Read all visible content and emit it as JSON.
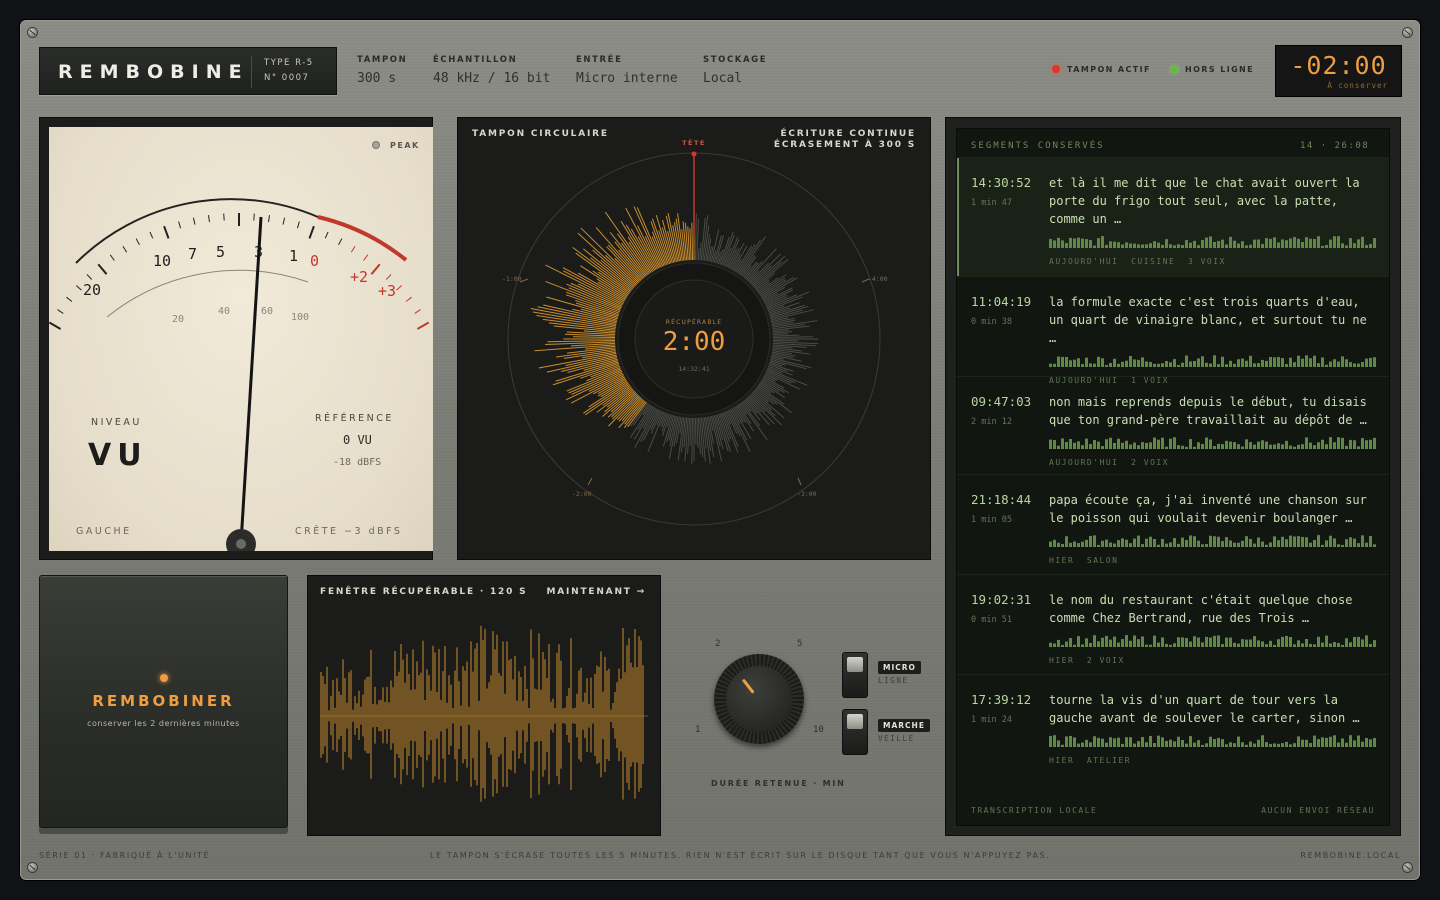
{
  "brand": {
    "name": "REMBOBINE",
    "type": "TYPE R-5",
    "serial": "N° 0007"
  },
  "specs": [
    {
      "label": "TAMPON",
      "value": "300 s"
    },
    {
      "label": "ÉCHANTILLON",
      "value": "48 kHz / 16 bit"
    },
    {
      "label": "ENTRÉE",
      "value": "Micro interne"
    },
    {
      "label": "STOCKAGE",
      "value": "Local"
    }
  ],
  "status": {
    "active": "TAMPON ACTIF",
    "offline": "HORS LIGNE",
    "active_color": "#d9372c",
    "offline_color": "#5bbf3a"
  },
  "timer": {
    "value": "-02:00",
    "sub": "À conserver"
  },
  "vu": {
    "peak": "PEAK",
    "scale_db": [
      "20",
      "10",
      "7",
      "5",
      "3",
      "1",
      "0",
      "+2",
      "+3"
    ],
    "scale_pct": [
      "20",
      "40",
      "60",
      "100"
    ],
    "niveau_label": "NIVEAU",
    "niveau_value": "VU",
    "reference_label": "RÉFÉRENCE",
    "reference_value": "0 VU",
    "reference_sub": "-18 dBFS",
    "left": "GAUCHE",
    "right": "CRÊTE −3 dBFS"
  },
  "circular": {
    "title": "TAMPON CIRCULAIRE",
    "mode_line1": "ÉCRITURE CONTINUE",
    "mode_line2": "ÉCRASEMENT À 300 S",
    "head": "TÊTE",
    "center_label": "RÉCUPÉRABLE",
    "center_value": "2:00",
    "center_time": "14:32:41",
    "ticks": [
      "-1:00",
      "-4:00",
      "-2:00",
      "-3:00"
    ]
  },
  "window": {
    "title": "FENÊTRE RÉCUPÉRABLE · 120 S",
    "now": "MAINTENANT →"
  },
  "rewind": {
    "label": "REMBOBINER",
    "sub": "conserver les 2 dernières minutes"
  },
  "knob": {
    "values": [
      "2",
      "5",
      "1",
      "10"
    ],
    "label": "DURÉE RETENUE · MIN",
    "current": 2
  },
  "toggles": [
    {
      "on": "MICRO",
      "off": "LIGNE"
    },
    {
      "on": "MARCHE",
      "off": "VEILLE"
    }
  ],
  "segments": {
    "title": "SEGMENTS CONSERVÉS",
    "count": "14",
    "total": "26:08",
    "items": [
      {
        "time": "14:30:52",
        "dur": "1 min 47",
        "lines": [
          "et là il me dit que le chat avait ouvert la",
          "porte du frigo tout seul, avec la patte,",
          "comme un …"
        ],
        "meta": "AUJOURD'HUI  CUISINE  3 VOIX"
      },
      {
        "time": "11:04:19",
        "dur": "0 min 38",
        "lines": [
          "la formule exacte c'est trois quarts d'eau,",
          "un quart de vinaigre blanc, et surtout tu ne",
          "…"
        ],
        "meta": "AUJOURD'HUI  1 VOIX"
      },
      {
        "time": "09:47:03",
        "dur": "2 min 12",
        "lines": [
          "non mais reprends depuis le début, tu disais",
          "que ton grand-père travaillait au dépôt de …"
        ],
        "meta": "AUJOURD'HUI  2 VOIX"
      },
      {
        "time": "21:18:44",
        "dur": "1 min 05",
        "lines": [
          "papa écoute ça, j'ai inventé une chanson sur",
          "le poisson qui voulait devenir boulanger …"
        ],
        "meta": "HIER  SALON"
      },
      {
        "time": "19:02:31",
        "dur": "0 min 51",
        "lines": [
          "le nom du restaurant c'était quelque chose",
          "comme Chez Bertrand, rue des Trois …"
        ],
        "meta": "HIER  2 VOIX"
      },
      {
        "time": "17:39:12",
        "dur": "1 min 24",
        "lines": [
          "tourne la vis d'un quart de tour vers la",
          "gauche avant de soulever le carter, sinon …"
        ],
        "meta": "HIER  ATELIER"
      }
    ],
    "footer_left": "TRANSCRIPTION LOCALE",
    "footer_right": "AUCUN ENVOI RÉSEAU"
  },
  "footer": {
    "left": "SÉRIE 01 · FABRIQUÉ À L'UNITÉ",
    "center": "LE TAMPON S'ÉCRASE TOUTES LES 5 MINUTES. RIEN N'EST ÉCRIT SUR LE DISQUE TANT QUE VOUS N'APPUYEZ PAS.",
    "right": "REMBOBINE.LOCAL"
  },
  "colors": {
    "amber": "#d69a34",
    "green_text": "#c8dfb2",
    "red": "#c0392b"
  }
}
